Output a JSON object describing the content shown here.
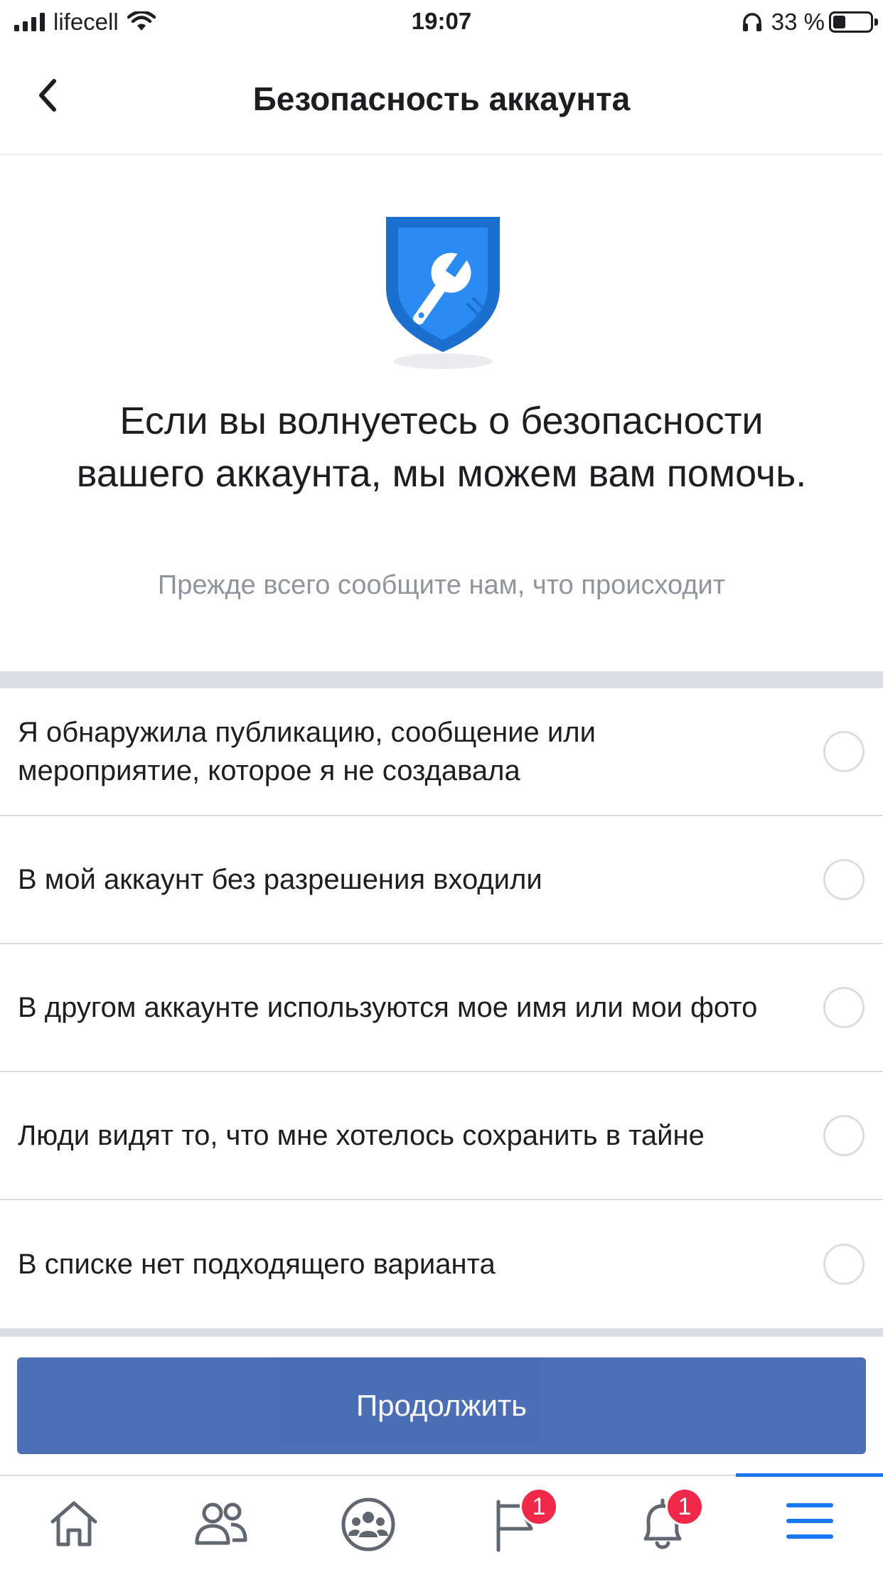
{
  "status_bar": {
    "carrier": "lifecell",
    "time": "19:07",
    "battery_percent": "33 %",
    "battery_level": 0.33
  },
  "header": {
    "title": "Безопасность аккаунта",
    "back_icon": "chevron-left-icon"
  },
  "hero": {
    "icon": "shield-wrench-icon",
    "heading": "Если вы волнуетесь о безопасности вашего аккаунта, мы можем вам помочь.",
    "subheading": "Прежде всего сообщите нам, что происходит"
  },
  "options": [
    {
      "label": "Я обнаружила публикацию, сообщение или мероприятие, которое я не создавала",
      "selected": false
    },
    {
      "label": "В мой аккаунт без разрешения входили",
      "selected": false
    },
    {
      "label": "В другом аккаунте используются мое имя или мои фото",
      "selected": false
    },
    {
      "label": "Люди видят то, что мне хотелось сохранить в тайне",
      "selected": false
    },
    {
      "label": "В списке нет подходящего варианта",
      "selected": false
    }
  ],
  "continue_button": {
    "label": "Продолжить"
  },
  "tab_bar": {
    "tabs": [
      {
        "icon": "home-icon",
        "badge": null
      },
      {
        "icon": "friends-icon",
        "badge": null
      },
      {
        "icon": "groups-icon",
        "badge": null
      },
      {
        "icon": "pages-flag-icon",
        "badge": "1"
      },
      {
        "icon": "bell-icon",
        "badge": "1"
      },
      {
        "icon": "menu-icon",
        "badge": null,
        "active": true
      }
    ]
  },
  "colors": {
    "accent": "#4267b2",
    "active_tab": "#1877f2",
    "badge": "#f02849",
    "shield_outer": "#1a6fcf",
    "shield_inner": "#2b8bf2"
  }
}
